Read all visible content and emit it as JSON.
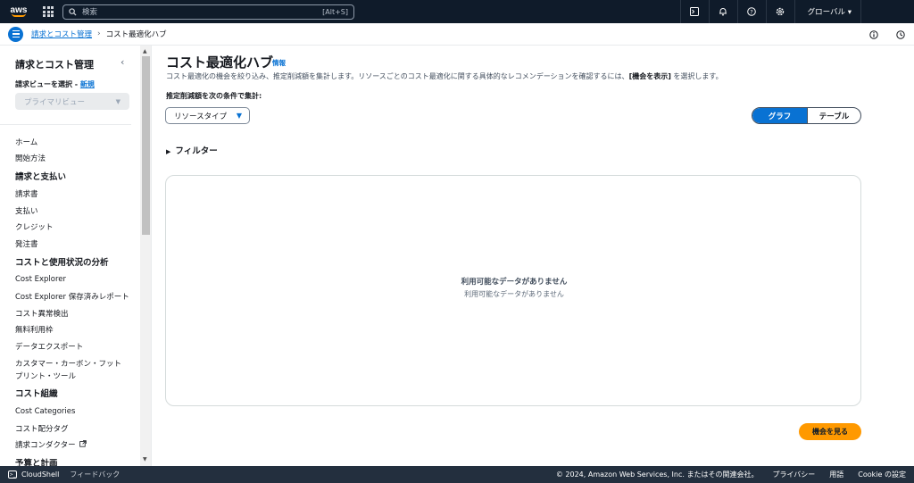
{
  "topbar": {
    "logo_text": "aws",
    "search_placeholder": "検索",
    "search_shortcut": "[Alt+S]",
    "region_label": "グローバル ▾",
    "icons": [
      "cloudshell-icon",
      "bell-icon",
      "help-icon",
      "settings-icon"
    ]
  },
  "breadcrumb": {
    "parent": "請求とコスト管理",
    "separator": "›",
    "current": "コスト最適化ハブ"
  },
  "sidebar": {
    "title": "請求とコスト管理",
    "view_label": "請求ビューを選択",
    "view_dash": " - ",
    "view_new": "新規",
    "view_select": "プライマリビュー",
    "items": [
      {
        "label": "ホーム",
        "head": false
      },
      {
        "label": "開始方法",
        "head": false
      },
      {
        "label": "請求と支払い",
        "head": true
      },
      {
        "label": "請求書",
        "head": false
      },
      {
        "label": "支払い",
        "head": false
      },
      {
        "label": "クレジット",
        "head": false
      },
      {
        "label": "発注書",
        "head": false
      },
      {
        "label": "コストと使用状況の分析",
        "head": true
      },
      {
        "label": "Cost Explorer",
        "head": false
      },
      {
        "label": "Cost Explorer 保存済みレポート",
        "head": false
      },
      {
        "label": "コスト異常検出",
        "head": false
      },
      {
        "label": "無料利用枠",
        "head": false
      },
      {
        "label": "データエクスポート",
        "head": false
      },
      {
        "label": "カスタマー・カーボン・フット",
        "head": false
      },
      {
        "label": "プリント・ツール",
        "head": false
      },
      {
        "label": "コスト組織",
        "head": true
      },
      {
        "label": "Cost Categories",
        "head": false
      },
      {
        "label": "コスト配分タグ",
        "head": false
      },
      {
        "label": "請求コンダクター",
        "head": false
      },
      {
        "label": "予算と計画",
        "head": true
      }
    ]
  },
  "main": {
    "title": "コスト最適化ハブ",
    "info": "情報",
    "description_a": "コスト最適化の機会を絞り込み、推定削減額を集計します。リソースごとのコスト最適化に関する具体的なレコメンデーションを確認するには、",
    "description_b": "[機会を表示]",
    "description_c": " を選択します。",
    "aggregate_label": "推定削減額を次の条件で集計:",
    "aggregate_value": "リソースタイプ",
    "view_toggle": {
      "graph": "グラフ",
      "table": "テーブル",
      "selected": "グラフ"
    },
    "filter_label": "フィルター",
    "empty_title": "利用可能なデータがありません",
    "empty_subtitle": "利用可能なデータがありません",
    "cta": "機会を見る"
  },
  "footer": {
    "cloudshell": "CloudShell",
    "feedback": "フィードバック",
    "copyright": "© 2024, Amazon Web Services, Inc. またはその関連会社。",
    "privacy": "プライバシー",
    "terms": "用語",
    "cookie": "Cookie の設定"
  },
  "colors": {
    "accent": "#0972d3",
    "cta": "#ff9900",
    "topbar": "#0f1b2a"
  }
}
